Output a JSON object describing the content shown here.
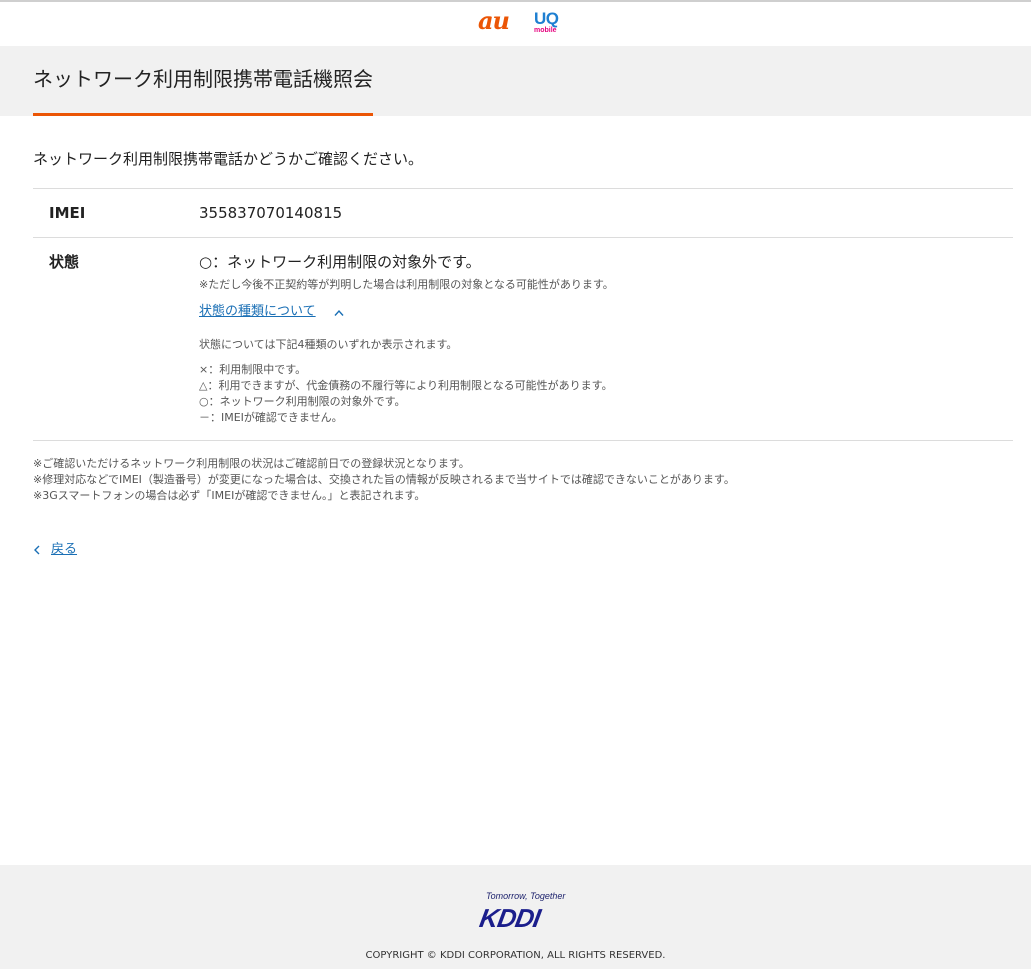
{
  "header": {
    "logo_au": "au",
    "logo_uq": "UQ",
    "logo_uq_sub": "mobile",
    "title": "ネットワーク利用制限携帯電話機照会"
  },
  "main": {
    "lead": "ネットワーク利用制限携帯電話かどうかご確認ください。",
    "imei": {
      "label": "IMEI",
      "value": "355837070140815"
    },
    "status": {
      "label": "状態",
      "value": "○：ネットワーク利用制限の対象外です。",
      "note": "※ただし今後不正契約等が判明した場合は利用制限の対象となる可能性があります。",
      "types_link": "状態の種類について",
      "types_intro": "状態については下記4種類のいずれか表示されます。",
      "types": [
        "×：利用制限中です。",
        "△：利用できますが、代金債務の不履行等により利用制限となる可能性があります。",
        "○：ネットワーク利用制限の対象外です。",
        "－：IMEIが確認できません。"
      ]
    },
    "footnotes": [
      "※ご確認いただけるネットワーク利用制限の状況はご確認前日での登録状況となります。",
      "※修理対応などでIMEI（製造番号）が変更になった場合は、交換された旨の情報が反映されるまで当サイトでは確認できないことがあります。",
      "※3Gスマートフォンの場合は必ず「IMEIが確認できません。」と表記されます。"
    ],
    "back_label": "戻る"
  },
  "footer": {
    "tagline": "Tomorrow, Together",
    "logo": "KDDI",
    "copyright": "COPYRIGHT © KDDI CORPORATION, ALL RIGHTS RESERVED."
  },
  "colors": {
    "accent": "#eb5505",
    "link": "#1a6fb5",
    "kddi_blue": "#1b1e8c",
    "uq_blue": "#1e7fd1",
    "uq_pink": "#e6007e",
    "band_gray": "#f1f1f1"
  }
}
